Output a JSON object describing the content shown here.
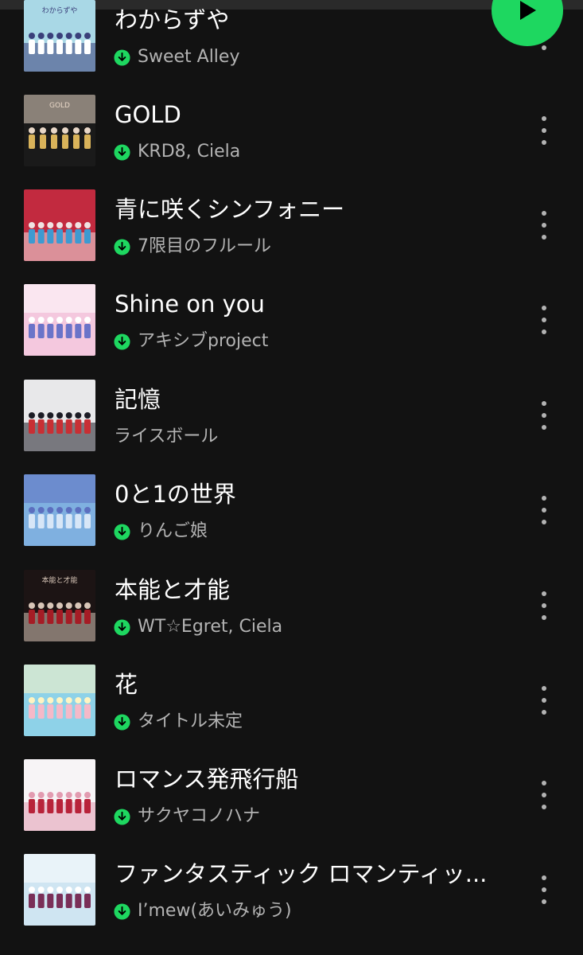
{
  "playlist": {
    "play_button": {
      "icon": "play-icon",
      "color": "#1ed760"
    },
    "tracks": [
      {
        "title": "わからずや",
        "artist": "Sweet Alley",
        "downloaded": true,
        "cover_palette": [
          "#a9d8e6",
          "#ffffff",
          "#3a3f7a"
        ],
        "cover_text": "わからずや"
      },
      {
        "title": "GOLD",
        "artist": "KRD8, Ciela",
        "downloaded": true,
        "cover_palette": [
          "#1a1a1a",
          "#d9b35a",
          "#e8d7c7"
        ],
        "cover_text": "GOLD"
      },
      {
        "title": "青に咲くシンフォニー",
        "artist": "7限目のフルール",
        "downloaded": true,
        "cover_palette": [
          "#c22a3f",
          "#3d9ad1",
          "#f0e3e3"
        ],
        "cover_text": ""
      },
      {
        "title": "Shine on you",
        "artist": "アキシブproject",
        "downloaded": true,
        "cover_palette": [
          "#f4c8de",
          "#6a74c9",
          "#ffffff"
        ],
        "cover_text": ""
      },
      {
        "title": "記憶",
        "artist": "ライスボール",
        "downloaded": false,
        "cover_palette": [
          "#e8e8ea",
          "#c82f34",
          "#1b1b24"
        ],
        "cover_text": ""
      },
      {
        "title": "0と1の世界",
        "artist": "りんご娘",
        "downloaded": true,
        "cover_palette": [
          "#7fb0e0",
          "#d7e6f7",
          "#5c6fbf"
        ],
        "cover_text": ""
      },
      {
        "title": "本能と才能",
        "artist": "WT☆Egret, Ciela",
        "downloaded": true,
        "cover_palette": [
          "#1c1414",
          "#a51c25",
          "#d8c6b8"
        ],
        "cover_text": "本能と才能"
      },
      {
        "title": "花",
        "artist": "タイトル未定",
        "downloaded": true,
        "cover_palette": [
          "#8ed2e8",
          "#f5b9c8",
          "#fff4c2"
        ],
        "cover_text": ""
      },
      {
        "title": "ロマンス発飛行船",
        "artist": "サクヤコノハナ",
        "downloaded": true,
        "cover_palette": [
          "#f7f4f6",
          "#b8233a",
          "#e29bb0"
        ],
        "cover_text": ""
      },
      {
        "title": "ファンタスティック ロマンティッ...",
        "artist": "I’mew(あいみゅう)",
        "downloaded": true,
        "cover_palette": [
          "#cfe5f2",
          "#7a2f58",
          "#ffffff"
        ],
        "cover_text": ""
      }
    ]
  },
  "icons": {
    "download": "download-icon",
    "more": "more-options-icon"
  },
  "colors": {
    "background": "#121212",
    "title": "#ffffff",
    "artist": "#b3b3b3",
    "accent": "#1ed760"
  }
}
